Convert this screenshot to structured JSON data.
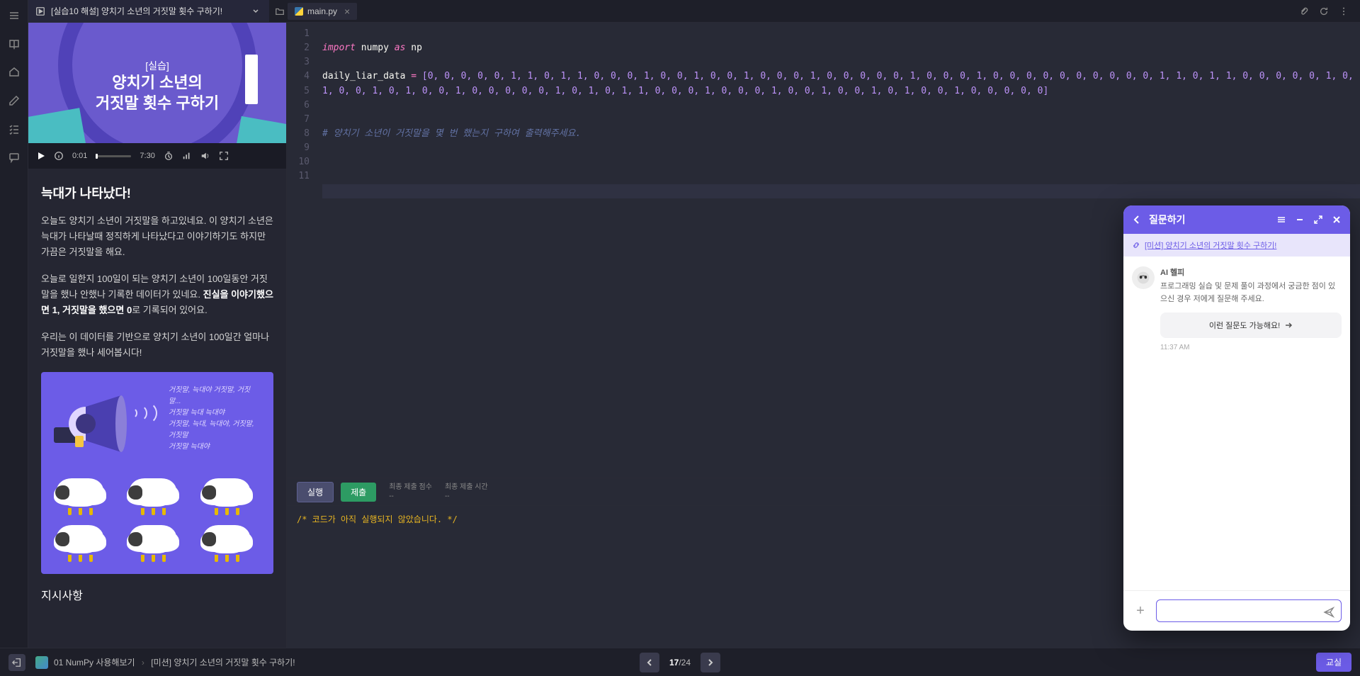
{
  "header": {
    "lesson_tab_title": "[실습10 해설] 양치기 소년의 거짓말 횟수 구하기!",
    "file_tab": "main.py"
  },
  "sidebar_icons": [
    "menu",
    "book",
    "home",
    "edit",
    "checklist",
    "chat"
  ],
  "video": {
    "tag": "[실습]",
    "title": "양치기 소년의\n거짓말 횟수 구하기",
    "current_time": "0:01",
    "duration": "7:30"
  },
  "lesson": {
    "h1": "늑대가 나타났다!",
    "p1": "오늘도 양치기 소년이 거짓말을 하고있네요. 이 양치기 소년은 늑대가 나타날때 정직하게 나타났다고 이야기하기도 하지만 가끔은 거짓말을 해요.",
    "p2a": "오늘로 일한지 100일이 되는 양치기 소년이 100일동안 거짓말을 했나 안했나 기록한 데이터가 있네요. ",
    "p2b": "진실을 이야기했으면 1, 거짓말을 했으면 0",
    "p2c": "로 기록되어 있어요.",
    "p3": "우리는 이 데이터를 기반으로 양치기 소년이 100일간 얼마나 거짓말을 했나 세어봅시다!",
    "illust_text": "거짓말, 늑대야 거짓말, 거짓말...\n거짓말 늑대 늑대야\n거짓말, 늑대, 늑대야, 거짓말, 거짓말\n거짓말 늑대야",
    "instructions_h": "지시사항"
  },
  "code": {
    "lines": [
      "1",
      "2",
      "3",
      "4",
      "5",
      "6",
      "7",
      "8",
      "9",
      "10",
      "11"
    ],
    "l2_import": "import",
    "l2_numpy": " numpy ",
    "l2_as": "as",
    "l2_np": " np",
    "l4_var": "daily_liar_data ",
    "l4_eq": "=",
    "l4_arr": " [0, 0, 0, 0, 0, 1, 1, 0, 1, 1, 0, 0, 0, 1, 0, 0, 1, 0, 0, 1, 0, 0, 0, 1, 0, 0, 0, 0, 0, 1, 0, 0, 0, 1, 0, 0, 0, 0, 0, 0, 0, 0, 0, 0, 1, 1, 0, 1, 1, 0, 0, 0, 0, 0, 1, 0, 1, 0, 0, 1, 0, 1, 0, 0, 1, 0, 0, 0, 0, 0, 1, 0, 1, 0, 1, 1, 0, 0, 0, 1, 0, 0, 0, 1, 0, 0, 1, 0, 0, 1, 0, 1, 0, 0, 1, 0, 0, 0, 0, 0]",
    "l7_comment": "# 양치기 소년이 거짓말을 몇 번 했는지 구하여 출력해주세요."
  },
  "runbar": {
    "run": "실행",
    "submit": "제출",
    "score_label": "최종 제출 점수",
    "score_val": "--",
    "time_label": "최종 제출 시간",
    "time_val": "--"
  },
  "console": {
    "output": "/* 코드가 아직 실행되지 않았습니다. */"
  },
  "bottombar": {
    "crumb1": "01 NumPy 사용해보기",
    "crumb2": "[미션] 양치기 소년의 거짓말 횟수 구하기!",
    "page_cur": "17",
    "page_total": "/24",
    "class_btn": "교실"
  },
  "chat": {
    "title": "질문하기",
    "link_text": "[미션] 양치기 소년의 거짓말 횟수 구하기!",
    "bot_name": "AI 헬피",
    "bot_msg": "프로그래밍 실습 및 문제 풀이 과정에서 궁금한 점이 있으신 경우 저에게 질문해 주세요.",
    "suggest": "이런 질문도 가능해요!",
    "time": "11:37 AM",
    "placeholder": ""
  }
}
